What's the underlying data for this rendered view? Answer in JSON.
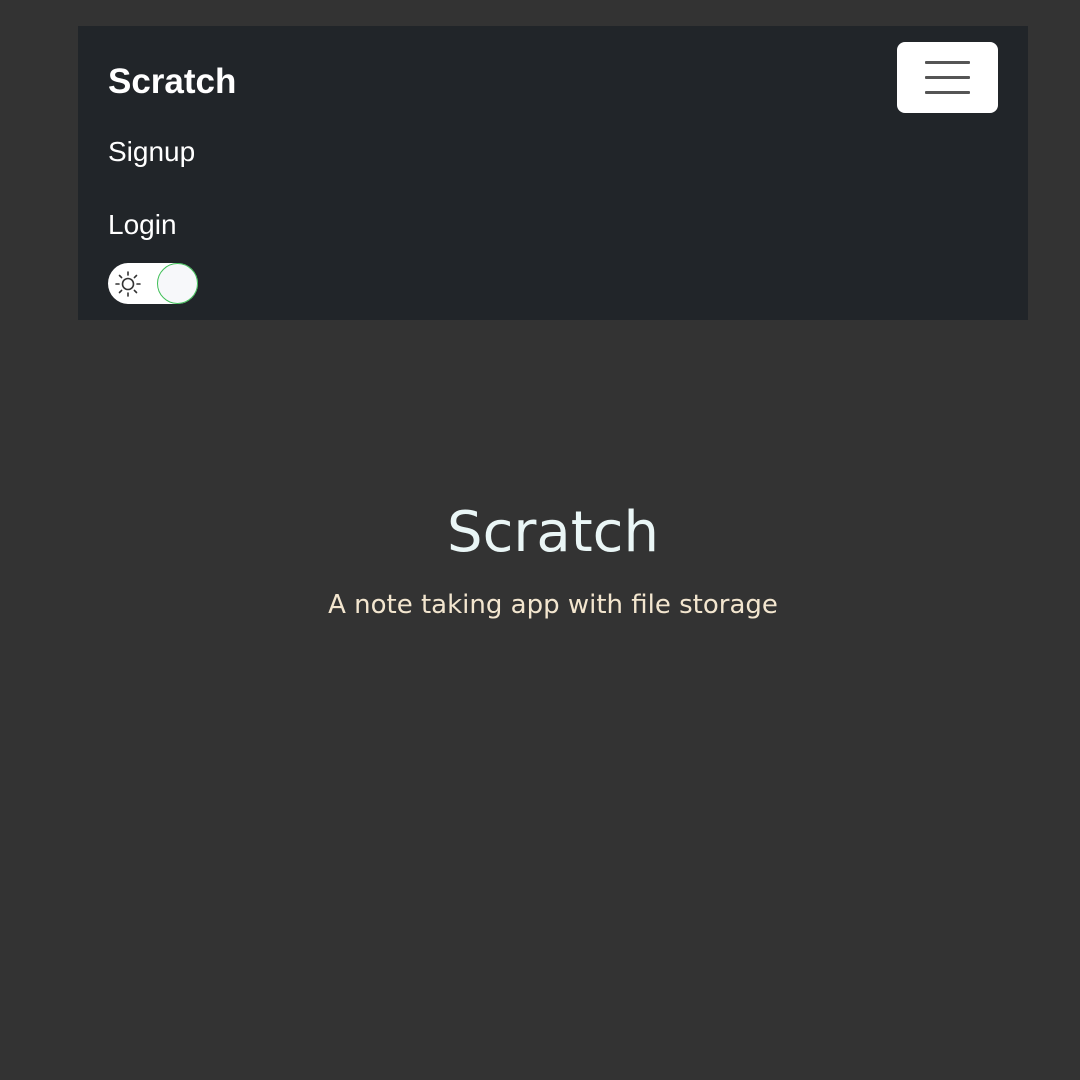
{
  "navbar": {
    "brand": "Scratch",
    "links": [
      "Signup",
      "Login"
    ],
    "toggler_icon": "hamburger-icon",
    "theme_toggle": {
      "icon": "sun-icon",
      "state": "light",
      "accent_color": "#3fbf57"
    }
  },
  "hero": {
    "title": "Scratch",
    "subtitle": "A note taking app with file storage"
  }
}
